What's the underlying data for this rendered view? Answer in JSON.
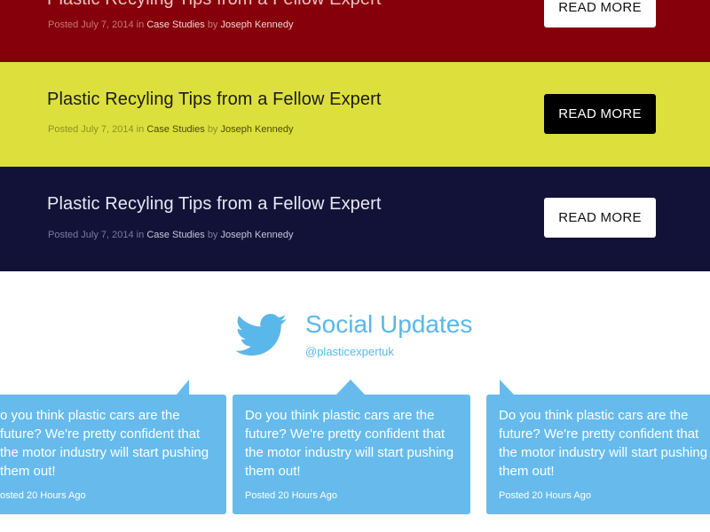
{
  "posts": [
    {
      "title": "Plastic Recyling Tips from a Fellow Expert",
      "meta_posted": "Posted July 7, 2014 in",
      "meta_category": "Case Studies",
      "meta_by": "by",
      "meta_author": "Joseph Kennedy",
      "button_label": "READ MORE",
      "color": "#85000a"
    },
    {
      "title": "Plastic Recyling Tips from a Fellow Expert",
      "meta_posted": "Posted July 7, 2014 in",
      "meta_category": "Case Studies",
      "meta_by": "by",
      "meta_author": "Joseph Kennedy",
      "button_label": "READ MORE",
      "color": "#dde03c"
    },
    {
      "title": "Plastic Recyling Tips from a Fellow Expert",
      "meta_posted": "Posted July 7, 2014 in",
      "meta_category": "Case Studies",
      "meta_by": "by",
      "meta_author": "Joseph Kennedy",
      "button_label": "READ MORE",
      "color": "#121239"
    }
  ],
  "social": {
    "icon": "twitter-bird-icon",
    "title": "Social Updates",
    "handle": "@plasticexpertuk",
    "accent": "#5ab7ea",
    "tweets": [
      {
        "text": "o you think plastic cars are the future? We're pretty confident that the motor industry will start pushing them out!",
        "time": "osted 20 Hours Ago"
      },
      {
        "text": "Do you think plastic cars are the future? We're pretty confident that the motor industry will start pushing them out!",
        "time": "Posted 20 Hours Ago"
      },
      {
        "text": "Do you think plastic cars are the future? We're pretty confident that the motor industry will start pushing them out!",
        "time": "Posted 20 Hours Ago"
      }
    ]
  }
}
